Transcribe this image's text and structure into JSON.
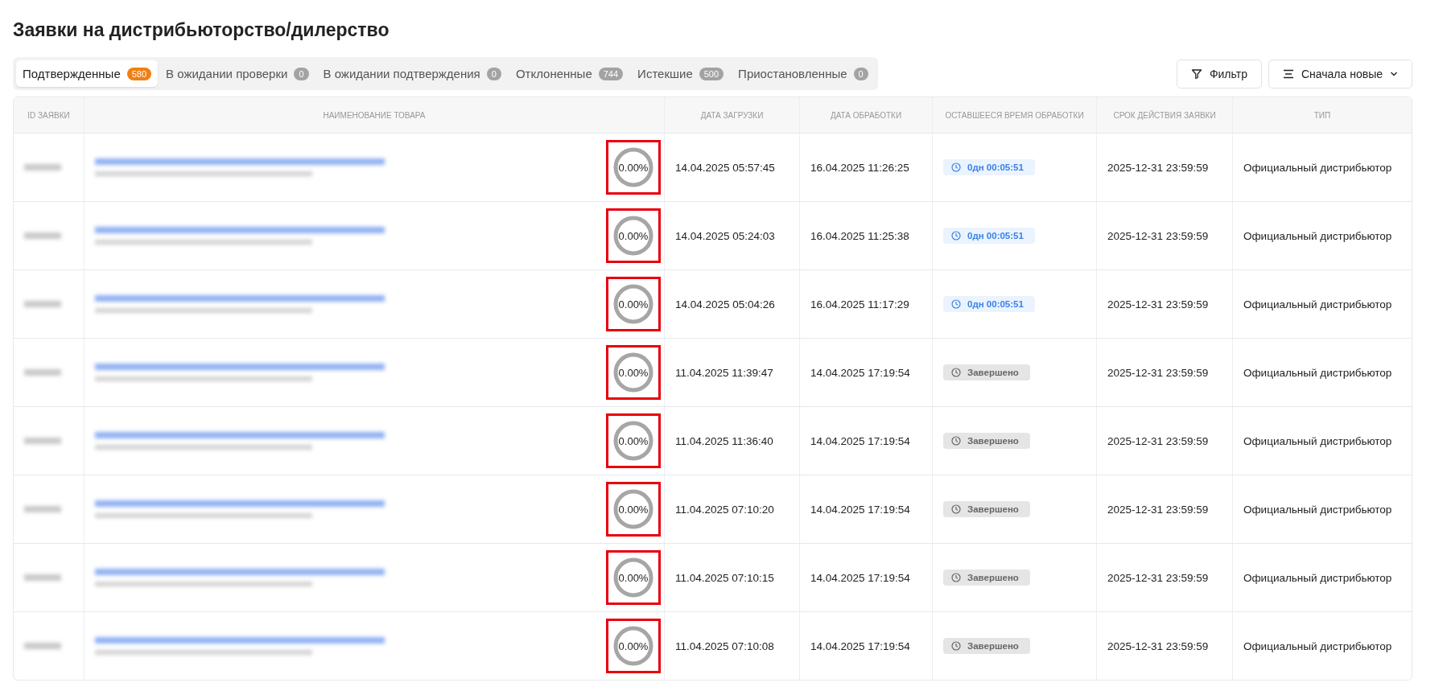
{
  "title": "Заявки на дистрибьюторство/дилерство",
  "tabs": [
    {
      "label": "Подтвержденные",
      "count": "580",
      "selected": true
    },
    {
      "label": "В ожидании проверки",
      "count": "0",
      "selected": false
    },
    {
      "label": "В ожидании подтверждения",
      "count": "0",
      "selected": false
    },
    {
      "label": "Отклоненные",
      "count": "744",
      "selected": false
    },
    {
      "label": "Истекшие",
      "count": "500",
      "selected": false
    },
    {
      "label": "Приостановленные",
      "count": "0",
      "selected": false
    }
  ],
  "filter_button": "Фильтр",
  "sort_button": "Сначала новые",
  "table": {
    "columns": [
      "ID ЗАЯВКИ",
      "НАИМЕНОВАНИЕ ТОВАРА",
      "ДАТА ЗАГРУЗКИ",
      "ДАТА ОБРАБОТКИ",
      "ОСТАВШЕЕСЯ ВРЕМЯ ОБРАБОТКИ",
      "СРОК ДЕЙСТВИЯ ЗАЯВКИ",
      "ТИП"
    ],
    "rows": [
      {
        "progress": "0.00%",
        "level": 0,
        "highlighted": true,
        "uploaded": "14.04.2025 05:57:45",
        "processed": "16.04.2025 11:26:25",
        "remaining": {
          "kind": "timer",
          "text": "0дн 00:05:51"
        },
        "valid_until": "2025-12-31 23:59:59",
        "type": "Официальный дистрибьютор"
      },
      {
        "progress": "0.00%",
        "level": 0,
        "highlighted": true,
        "uploaded": "14.04.2025 05:24:03",
        "processed": "16.04.2025 11:25:38",
        "remaining": {
          "kind": "timer",
          "text": "0дн 00:05:51"
        },
        "valid_until": "2025-12-31 23:59:59",
        "type": "Официальный дистрибьютор"
      },
      {
        "progress": "0.00%",
        "level": 0,
        "highlighted": true,
        "uploaded": "14.04.2025 05:04:26",
        "processed": "16.04.2025 11:17:29",
        "remaining": {
          "kind": "timer",
          "text": "0дн 00:05:51"
        },
        "valid_until": "2025-12-31 23:59:59",
        "type": "Официальный дистрибьютор"
      },
      {
        "progress": "0.00%",
        "level": 0,
        "highlighted": true,
        "uploaded": "11.04.2025 11:39:47",
        "processed": "14.04.2025 17:19:54",
        "remaining": {
          "kind": "done",
          "text": "Завершено"
        },
        "valid_until": "2025-12-31 23:59:59",
        "type": "Официальный дистрибьютор"
      },
      {
        "progress": "0.00%",
        "level": 0,
        "highlighted": true,
        "uploaded": "11.04.2025 11:36:40",
        "processed": "14.04.2025 17:19:54",
        "remaining": {
          "kind": "done",
          "text": "Завершено"
        },
        "valid_until": "2025-12-31 23:59:59",
        "type": "Официальный дистрибьютор"
      },
      {
        "progress": "0.00%",
        "level": 0,
        "highlighted": true,
        "uploaded": "11.04.2025 07:10:20",
        "processed": "14.04.2025 17:19:54",
        "remaining": {
          "kind": "done",
          "text": "Завершено"
        },
        "valid_until": "2025-12-31 23:59:59",
        "type": "Официальный дистрибьютор"
      },
      {
        "progress": "0.00%",
        "level": 0,
        "highlighted": true,
        "uploaded": "11.04.2025 07:10:15",
        "processed": "14.04.2025 17:19:54",
        "remaining": {
          "kind": "done",
          "text": "Завершено"
        },
        "valid_until": "2025-12-31 23:59:59",
        "type": "Официальный дистрибьютор"
      },
      {
        "progress": "0.00%",
        "level": 0,
        "highlighted": true,
        "uploaded": "11.04.2025 07:10:08",
        "processed": "14.04.2025 17:19:54",
        "remaining": {
          "kind": "done",
          "text": "Завершено"
        },
        "valid_until": "2025-12-31 23:59:59",
        "type": "Официальный дистрибьютор"
      }
    ]
  }
}
